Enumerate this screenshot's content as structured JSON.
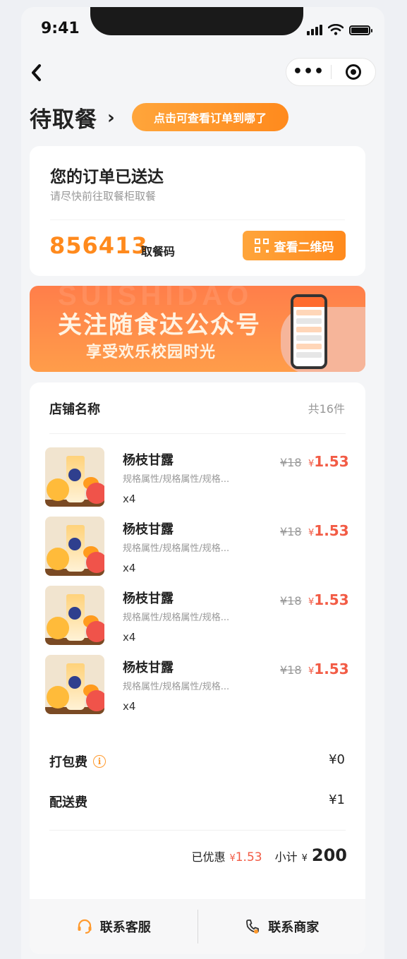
{
  "status_bar": {
    "time": "9:41"
  },
  "nav": {
    "back_icon": "chevron-left-icon",
    "more_icon": "more-dots-icon",
    "capsule_icon": "target-icon"
  },
  "header": {
    "title": "待取餐",
    "track_button": "点击可查看订单到哪了"
  },
  "order_status": {
    "heading": "您的订单已送达",
    "subtext": "请尽快前往取餐柜取餐",
    "pickup_code": "856413",
    "pickup_code_label": "取餐码",
    "qr_button": "查看二维码"
  },
  "banner": {
    "watermark": "SUISHIDAO",
    "title": "关注随食达公众号",
    "subtitle": "享受欢乐校园时光"
  },
  "order": {
    "store_name": "店铺名称",
    "item_count": "共16件",
    "items": [
      {
        "name": "杨枝甘露",
        "spec": "规格属性/规格属性/规格...",
        "qty": "x4",
        "old_price": "¥18",
        "currency": "¥",
        "price": "1.53"
      },
      {
        "name": "杨枝甘露",
        "spec": "规格属性/规格属性/规格...",
        "qty": "x4",
        "old_price": "¥18",
        "currency": "¥",
        "price": "1.53"
      },
      {
        "name": "杨枝甘露",
        "spec": "规格属性/规格属性/规格...",
        "qty": "x4",
        "old_price": "¥18",
        "currency": "¥",
        "price": "1.53"
      },
      {
        "name": "杨枝甘露",
        "spec": "规格属性/规格属性/规格...",
        "qty": "x4",
        "old_price": "¥18",
        "currency": "¥",
        "price": "1.53"
      }
    ],
    "packing_fee_label": "打包费",
    "packing_fee": "¥0",
    "delivery_fee_label": "配送费",
    "delivery_fee": "¥1",
    "discount_label": "已优惠",
    "discount_currency": "¥",
    "discount": "1.53",
    "subtotal_label": "小计",
    "subtotal_currency": "¥",
    "subtotal": "200"
  },
  "footer": {
    "contact_service": "联系客服",
    "contact_merchant": "联系商家"
  },
  "colors": {
    "accent": "#ff8a1d",
    "price": "#f25b45",
    "background": "#f4f5f7"
  }
}
